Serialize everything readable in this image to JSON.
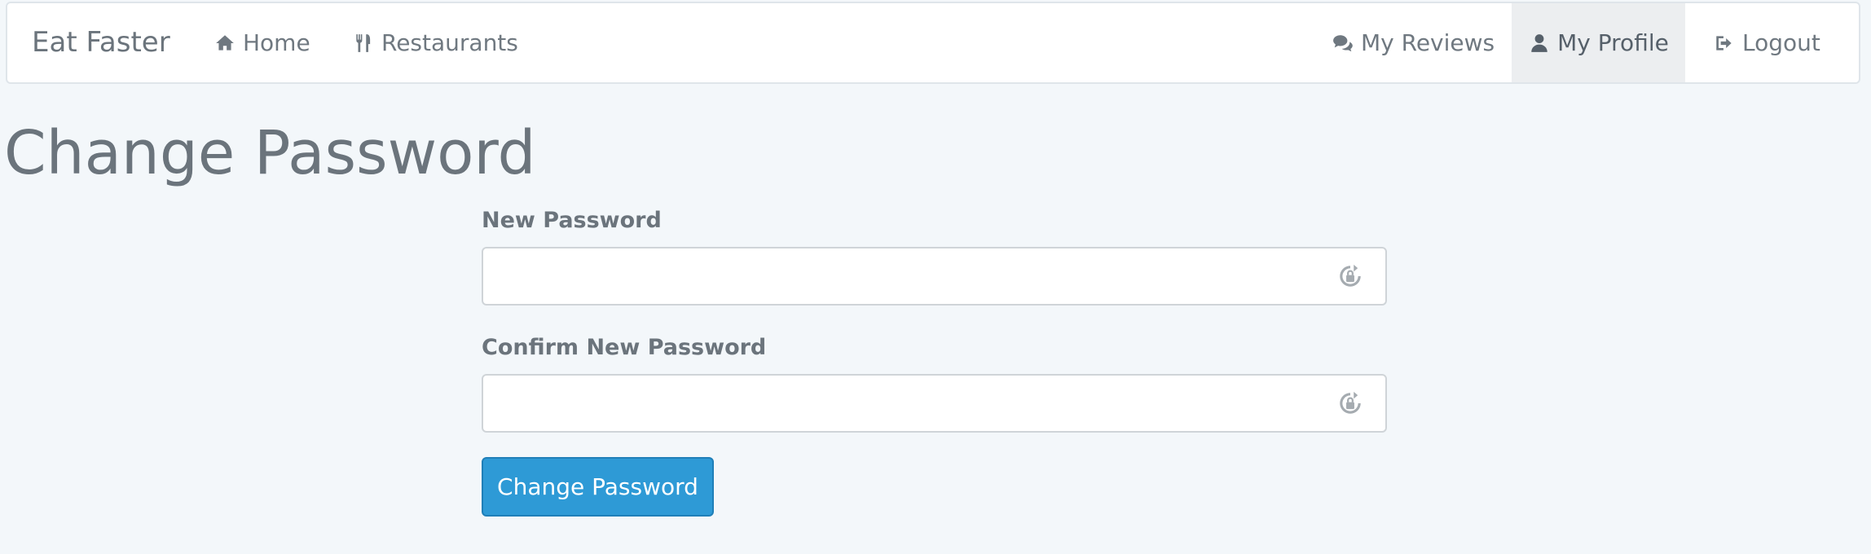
{
  "navbar": {
    "brand": "Eat Faster",
    "left_items": [
      {
        "label": "Home",
        "icon": "home-icon"
      },
      {
        "label": "Restaurants",
        "icon": "cutlery-icon"
      }
    ],
    "right_items": [
      {
        "label": "My Reviews",
        "icon": "comments-icon"
      },
      {
        "label": "My Profile",
        "icon": "user-icon",
        "active": true
      },
      {
        "label": "Logout",
        "icon": "logout-icon"
      }
    ]
  },
  "page": {
    "title": "Change Password"
  },
  "form": {
    "new_password": {
      "label": "New Password",
      "value": "",
      "icon": "password-manager-icon"
    },
    "confirm_password": {
      "label": "Confirm New Password",
      "value": "",
      "icon": "password-manager-icon"
    },
    "submit_label": "Change Password"
  },
  "colors": {
    "background": "#f3f7fa",
    "primary": "#2e9ad6",
    "text": "#6b747c",
    "active_nav": "#eceef0"
  }
}
